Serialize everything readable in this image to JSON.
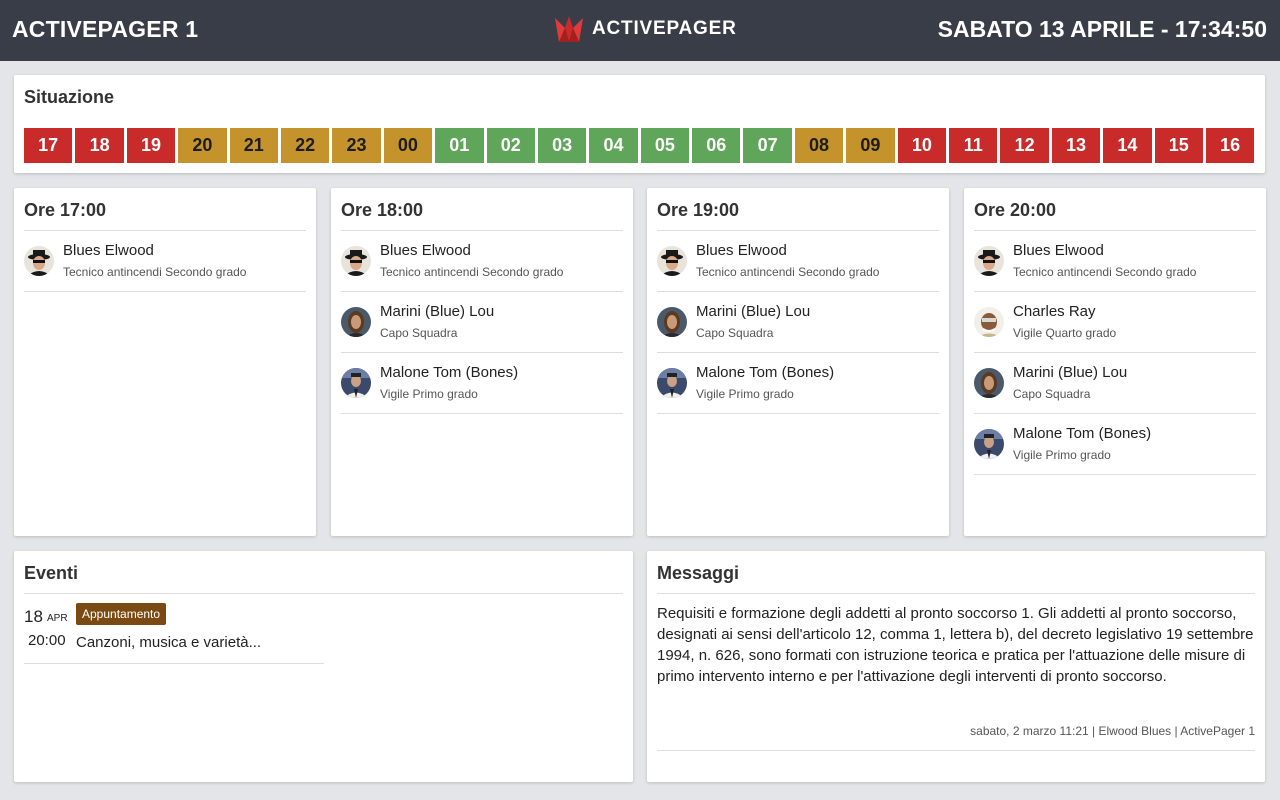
{
  "header": {
    "title": "ACTIVEPAGER 1",
    "brand": "ACTIVEPAGER",
    "clock": "SABATO 13 APRILE - 17:34:50",
    "brand_color": "#c92a2a"
  },
  "situazione": {
    "title": "Situazione",
    "hours": [
      {
        "label": "17",
        "status": "red"
      },
      {
        "label": "18",
        "status": "red"
      },
      {
        "label": "19",
        "status": "red"
      },
      {
        "label": "20",
        "status": "amber"
      },
      {
        "label": "21",
        "status": "amber"
      },
      {
        "label": "22",
        "status": "amber"
      },
      {
        "label": "23",
        "status": "amber"
      },
      {
        "label": "00",
        "status": "amber"
      },
      {
        "label": "01",
        "status": "green"
      },
      {
        "label": "02",
        "status": "green"
      },
      {
        "label": "03",
        "status": "green"
      },
      {
        "label": "04",
        "status": "green"
      },
      {
        "label": "05",
        "status": "green"
      },
      {
        "label": "06",
        "status": "green"
      },
      {
        "label": "07",
        "status": "green"
      },
      {
        "label": "08",
        "status": "amber"
      },
      {
        "label": "09",
        "status": "amber"
      },
      {
        "label": "10",
        "status": "red"
      },
      {
        "label": "11",
        "status": "red"
      },
      {
        "label": "12",
        "status": "red"
      },
      {
        "label": "13",
        "status": "red"
      },
      {
        "label": "14",
        "status": "red"
      },
      {
        "label": "15",
        "status": "red"
      },
      {
        "label": "16",
        "status": "red"
      }
    ],
    "status_colors": {
      "red": "#c92a2a",
      "amber": "#c5932b",
      "green": "#5fa55a"
    }
  },
  "shifts": [
    {
      "title": "Ore 17:00",
      "people": [
        {
          "name": "Blues Elwood",
          "role": "Tecnico antincendi Secondo grado",
          "avatar": "avatar-elwood"
        }
      ]
    },
    {
      "title": "Ore 18:00",
      "people": [
        {
          "name": "Blues Elwood",
          "role": "Tecnico antincendi Secondo grado",
          "avatar": "avatar-elwood"
        },
        {
          "name": "Marini (Blue) Lou",
          "role": "Capo Squadra",
          "avatar": "avatar-lou"
        },
        {
          "name": "Malone Tom (Bones)",
          "role": "Vigile Primo grado",
          "avatar": "avatar-tom"
        }
      ]
    },
    {
      "title": "Ore 19:00",
      "people": [
        {
          "name": "Blues Elwood",
          "role": "Tecnico antincendi Secondo grado",
          "avatar": "avatar-elwood"
        },
        {
          "name": "Marini (Blue) Lou",
          "role": "Capo Squadra",
          "avatar": "avatar-lou"
        },
        {
          "name": "Malone Tom (Bones)",
          "role": "Vigile Primo grado",
          "avatar": "avatar-tom"
        }
      ]
    },
    {
      "title": "Ore 20:00",
      "people": [
        {
          "name": "Blues Elwood",
          "role": "Tecnico antincendi Secondo grado",
          "avatar": "avatar-elwood"
        },
        {
          "name": "Charles Ray",
          "role": "Vigile Quarto grado",
          "avatar": "avatar-ray"
        },
        {
          "name": "Marini (Blue) Lou",
          "role": "Capo Squadra",
          "avatar": "avatar-lou"
        },
        {
          "name": "Malone Tom (Bones)",
          "role": "Vigile Primo grado",
          "avatar": "avatar-tom"
        }
      ]
    }
  ],
  "eventi": {
    "title": "Eventi",
    "items": [
      {
        "day": "18",
        "month": "APR",
        "time": "20:00",
        "badge": "Appuntamento",
        "text": "Canzoni, musica e varietà...",
        "badge_color": "#7a4a12"
      }
    ]
  },
  "messaggi": {
    "title": "Messaggi",
    "body": "Requisiti e formazione degli addetti al pronto soccorso 1. Gli addetti al pronto soccorso, designati ai sensi dell'articolo 12, comma 1, lettera b), del decreto legislativo 19 settembre 1994, n. 626, sono formati con istruzione teorica e pratica per l'attuazione delle misure di primo intervento interno e per l'attivazione degli interventi di pronto soccorso.",
    "meta": "sabato, 2 marzo 11:21 | Elwood Blues | ActivePager 1"
  }
}
